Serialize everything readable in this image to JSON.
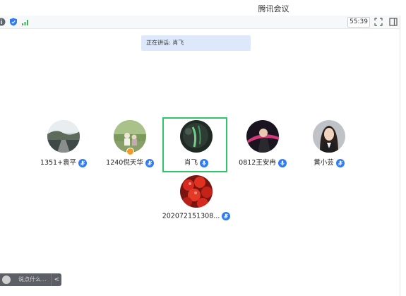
{
  "window": {
    "title": "腾讯会议"
  },
  "toolbar": {
    "timer": "55:39"
  },
  "speaking": {
    "label": "正在讲话: 肖飞"
  },
  "participants": [
    {
      "name": "1351+袁平"
    },
    {
      "name": "1240倪天华"
    },
    {
      "name": "肖飞"
    },
    {
      "name": "0812王安冉"
    },
    {
      "name": "黄小芸"
    },
    {
      "name": "202072151308..."
    }
  ],
  "chat": {
    "placeholder": "说点什么...",
    "collapse": "<"
  },
  "colors": {
    "accent": "#2f7bf5",
    "active_border": "#2fc56b",
    "speaking_bg": "#dde8fb"
  }
}
